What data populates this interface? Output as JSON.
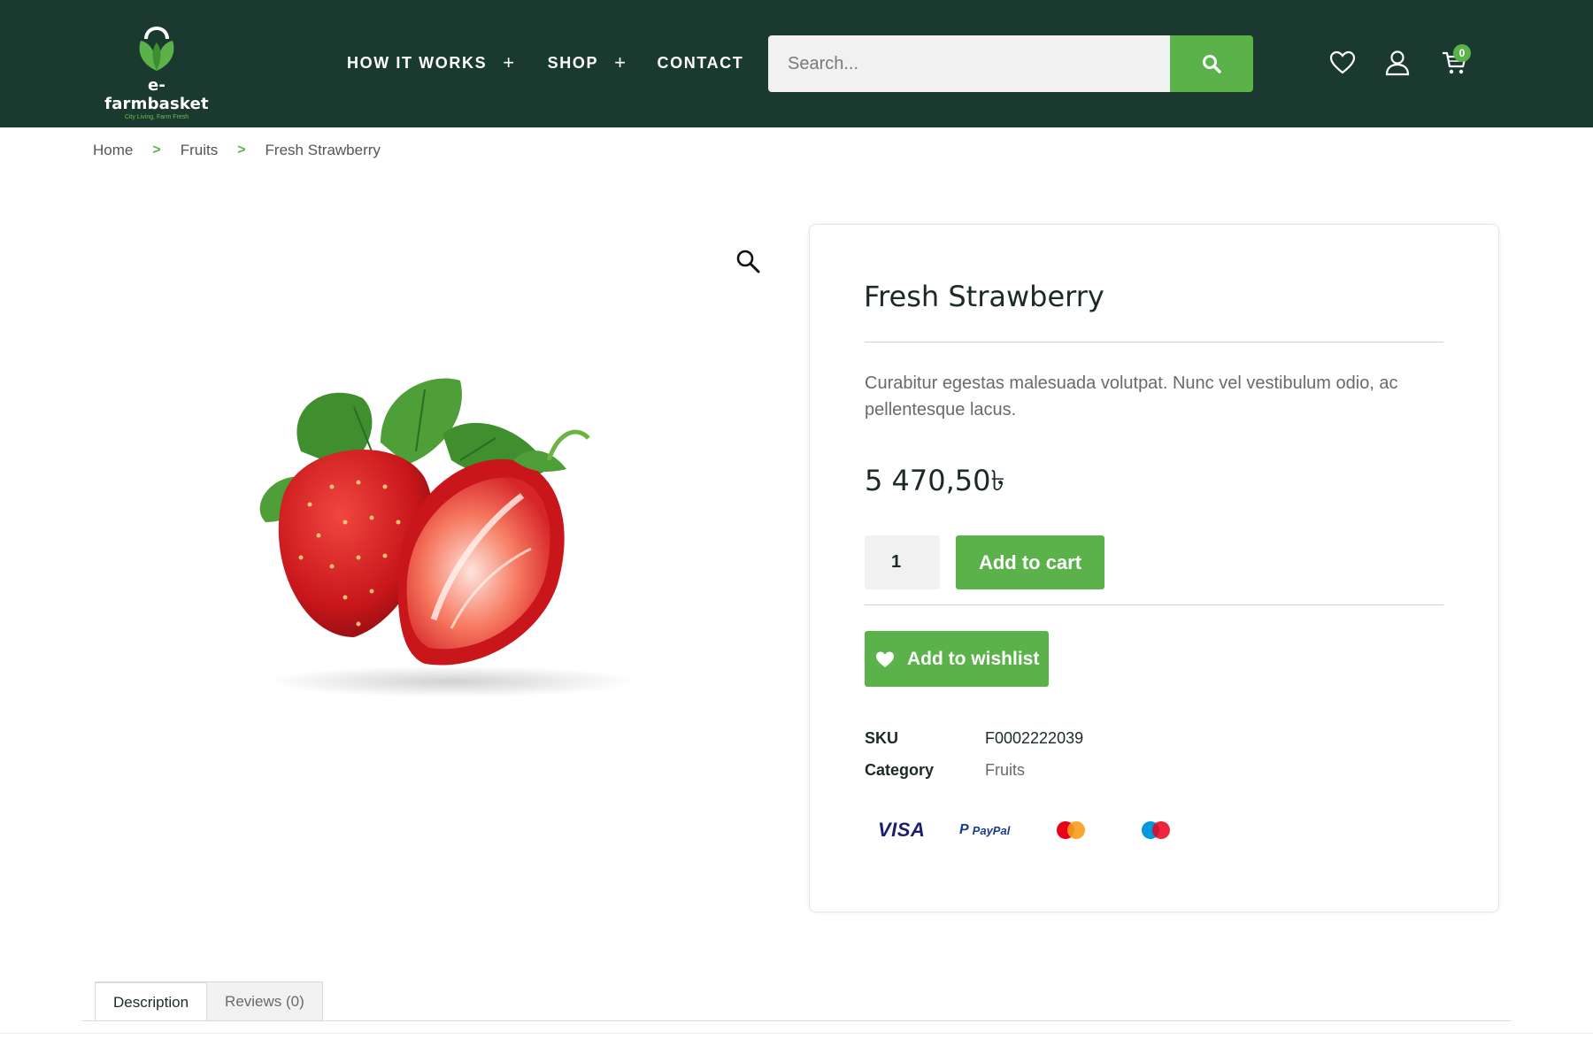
{
  "brand": {
    "name": "e-farmbasket",
    "tagline": "City Living, Farm Fresh"
  },
  "nav": {
    "items": [
      {
        "label": "HOW IT WORKS",
        "has_submenu": true
      },
      {
        "label": "SHOP",
        "has_submenu": true
      },
      {
        "label": "CONTACT",
        "has_submenu": false
      }
    ],
    "submenu_symbol": "+"
  },
  "search": {
    "placeholder": "Search...",
    "value": ""
  },
  "header_icons": [
    "heart-icon",
    "user-icon",
    "cart-icon"
  ],
  "cart": {
    "count": "0"
  },
  "breadcrumb": {
    "items": [
      "Home",
      "Fruits",
      "Fresh Strawberry"
    ],
    "separator": ">"
  },
  "product": {
    "title": "Fresh Strawberry",
    "short_description": "Curabitur egestas malesuada volutpat. Nunc vel vestibulum odio, ac pellentesque lacus.",
    "price": "5 470,50৳",
    "quantity": "1",
    "add_to_cart_label": "Add to cart",
    "wishlist_label": "Add to wishlist",
    "sku_label": "SKU",
    "sku": "F0002222039",
    "category_label": "Category",
    "category": "Fruits"
  },
  "payment_methods": {
    "visa": "VISA",
    "paypal": "PayPal"
  },
  "tabs": [
    {
      "label": "Description",
      "active": true
    },
    {
      "label": "Reviews (0)",
      "active": false
    }
  ],
  "colors": {
    "header_bg": "#1b3a2f",
    "accent": "#5cb24a",
    "text_dark": "#1b2a25",
    "text_muted": "#6a6a6a"
  }
}
